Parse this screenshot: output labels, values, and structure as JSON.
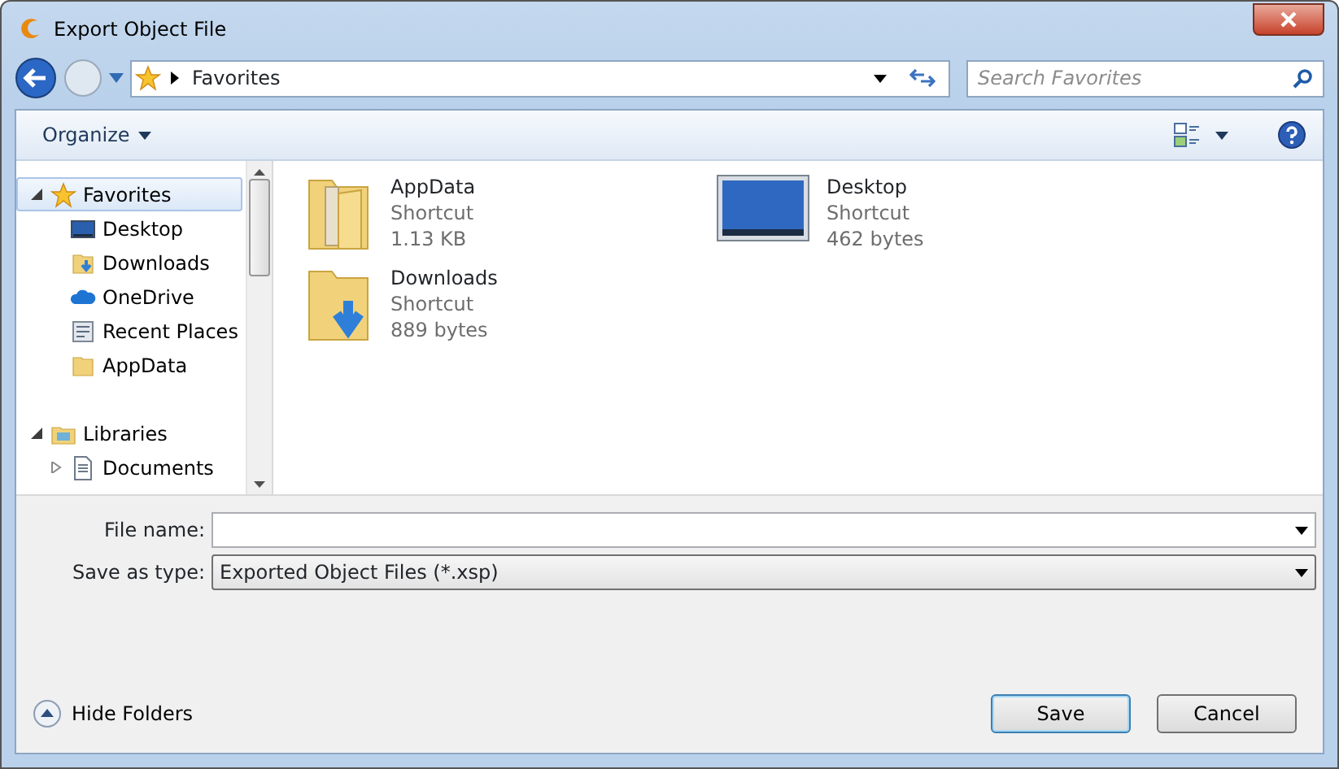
{
  "window": {
    "title": "Export Object File"
  },
  "address_bar": {
    "path": [
      "Favorites"
    ]
  },
  "search": {
    "placeholder": "Search Favorites"
  },
  "toolbar": {
    "organize": "Organize"
  },
  "sidebar": {
    "items": [
      {
        "label": "Favorites",
        "kind": "favorites",
        "expanded": true,
        "selected": true,
        "children": [
          {
            "label": "Desktop",
            "kind": "desktop",
            "selected": false
          },
          {
            "label": "Downloads",
            "kind": "downloads",
            "selected": false
          },
          {
            "label": "OneDrive",
            "kind": "cloud",
            "selected": false
          },
          {
            "label": "Recent Places",
            "kind": "recent",
            "selected": false
          },
          {
            "label": "AppData",
            "kind": "folder",
            "selected": false
          }
        ]
      },
      {
        "label": "Libraries",
        "kind": "libraries",
        "expanded": true,
        "selected": false,
        "children": [
          {
            "label": "Documents",
            "kind": "documents",
            "expanded": false,
            "selected": false
          }
        ]
      }
    ]
  },
  "files": [
    {
      "name": "AppData",
      "type": "Shortcut",
      "size": "1.13 KB",
      "kind": "folder",
      "selected": false
    },
    {
      "name": "Desktop",
      "type": "Shortcut",
      "size": "462 bytes",
      "kind": "desktop",
      "selected": false
    },
    {
      "name": "Downloads",
      "type": "Shortcut",
      "size": "889 bytes",
      "kind": "downloads",
      "selected": false
    }
  ],
  "form": {
    "file_name_label": "File name:",
    "save_type_label": "Save as type:",
    "save_type": "Exported Object Files (*.xsp)"
  },
  "footer": {
    "hide_folders": "Hide Folders",
    "buttons": [
      {
        "label": "Save",
        "default": true
      },
      {
        "label": "Cancel",
        "default": false
      }
    ]
  }
}
